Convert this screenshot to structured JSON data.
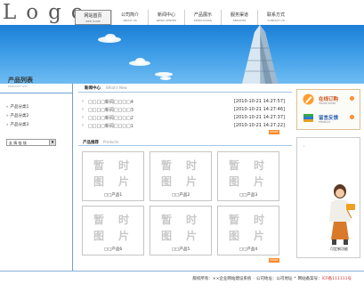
{
  "header": {
    "logo": "Logo",
    "nav": [
      {
        "label": "网站首页",
        "en": "WEB HOME",
        "active": true
      },
      {
        "label": "公司简介",
        "en": "ABOUT US"
      },
      {
        "label": "新闻中心",
        "en": "NEWS CENTER"
      },
      {
        "label": "产品展示",
        "en": "PRODUCTING"
      },
      {
        "label": "服务渠道",
        "en": "SERVICES"
      },
      {
        "label": "联系方式",
        "en": "CONTACT US"
      }
    ]
  },
  "sidebar": {
    "title": "产品列表",
    "subtitle": "PRODUCT LIST",
    "items": [
      "产品分类1",
      "产品分类2",
      "产品分类3"
    ],
    "friend_links_label": "友 情 链 接"
  },
  "news": {
    "title": "新闻中心",
    "title_en": "What's New",
    "items": [
      {
        "title": "□□□□新闻□□□□4",
        "date": "[2010-10-21 14:27:57]"
      },
      {
        "title": "□□□□新闻□□□□3",
        "date": "[2010-10-21 14:27:46]"
      },
      {
        "title": "□□□□新闻□□□□2",
        "date": "[2010-10-21 14:27:37]"
      },
      {
        "title": "□□□□新闻□□□□1",
        "date": "[2010-10-21 14:27:22]"
      }
    ],
    "more": "MORE"
  },
  "products": {
    "title": "产品推荐",
    "title_en": "Products",
    "placeholder_chars": [
      "暂",
      "时",
      "图",
      "片"
    ],
    "items": [
      "□□产品1",
      "□□产品2",
      "□□产品3",
      "□□产品6",
      "□□产品5",
      "□□产品4"
    ],
    "more": "MORE"
  },
  "right": {
    "order": {
      "label": "在线订购",
      "sub": "ONLINE ORDER"
    },
    "feedback": {
      "label": "留言反馈",
      "sub": "FEEDBACK"
    },
    "help": "可定制功能"
  },
  "footer": {
    "copyright": "版权所有：××企业网站建设系统",
    "address": "公司地址：公司地址",
    "icp_label": "网站备案号：",
    "icp_value": "ICP备111111号"
  },
  "colors": {
    "banner": "#3b9be6",
    "accent": "#ff8a2a",
    "divider": "#6f9fd6"
  }
}
